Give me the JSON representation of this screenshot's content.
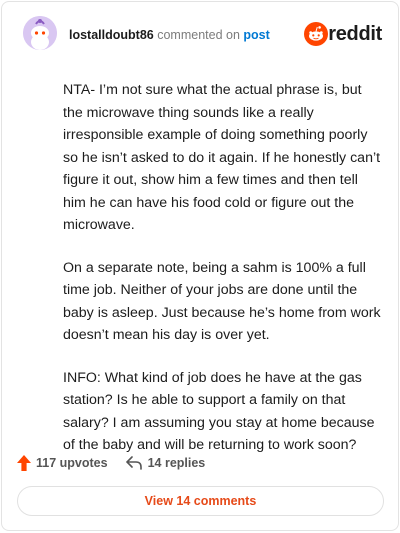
{
  "header": {
    "username": "lostalldoubt86",
    "verb": "commented on",
    "post_link": "post",
    "brand_wordmark": "reddit"
  },
  "comment": {
    "paragraphs": [
      "NTA- I’m not sure what the actual phrase is, but the microwave thing sounds like a really irresponsible example of doing something poorly so he isn’t asked to do it again. If he honestly can’t figure it out, show him a few times and then tell him he can have his food cold or figure out the microwave.",
      "On a separate note, being a sahm is 100% a full time job. Neither of your jobs are done until the baby is asleep. Just because he’s home from work doesn’t mean his day is over yet.",
      "INFO: What kind of job does he have at the gas station? Is he able to support a family on that salary? I am assuming you stay at home because of the baby and will be returning to work soon?"
    ]
  },
  "actions": {
    "upvotes_label": "117 upvotes",
    "replies_label": "14 replies",
    "view_comments_label": "View 14 comments"
  },
  "colors": {
    "accent": "#ff4500",
    "link": "#0079d3",
    "view_button_text": "#e64a19"
  }
}
